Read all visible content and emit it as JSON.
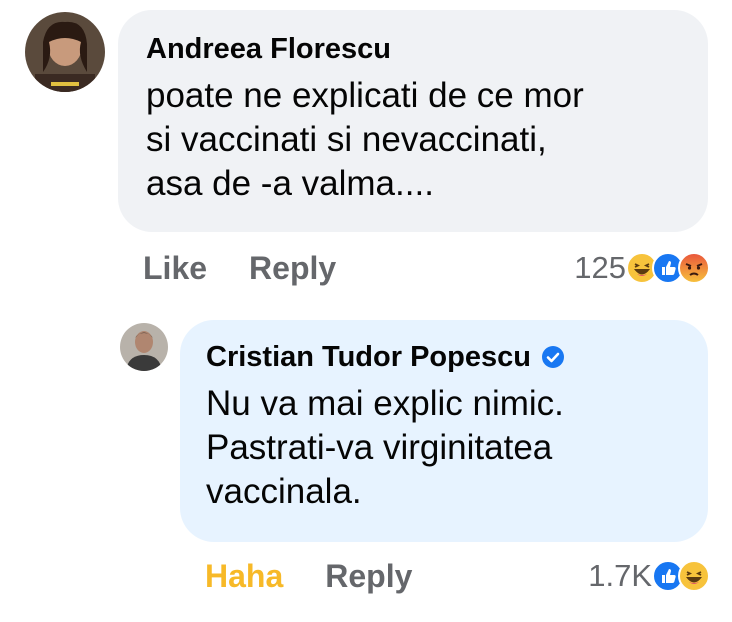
{
  "comments": [
    {
      "author": "Andreea Florescu",
      "text_lines": [
        "poate ne explicati de ce mor",
        "si vaccinati si nevaccinati,",
        "asa de -a valma...."
      ],
      "actions": {
        "like": "Like",
        "reply": "Reply"
      },
      "reaction_count": "125",
      "reaction_icons": [
        "haha-icon",
        "like-icon",
        "angry-icon"
      ]
    },
    {
      "author": "Cristian Tudor Popescu",
      "verified": true,
      "text_lines": [
        "Nu va mai explic nimic.",
        "Pastrati-va virginitatea",
        "vaccinala."
      ],
      "actions": {
        "reaction": "Haha",
        "reply": "Reply"
      },
      "reaction_count": "1.7K",
      "reaction_icons": [
        "like-icon",
        "haha-icon"
      ]
    }
  ],
  "colors": {
    "bubble": "#f0f2f5",
    "reply_bubble": "#e7f3ff",
    "action_text": "#65676b",
    "haha_active": "#f7b928",
    "verified": "#1877f2"
  }
}
